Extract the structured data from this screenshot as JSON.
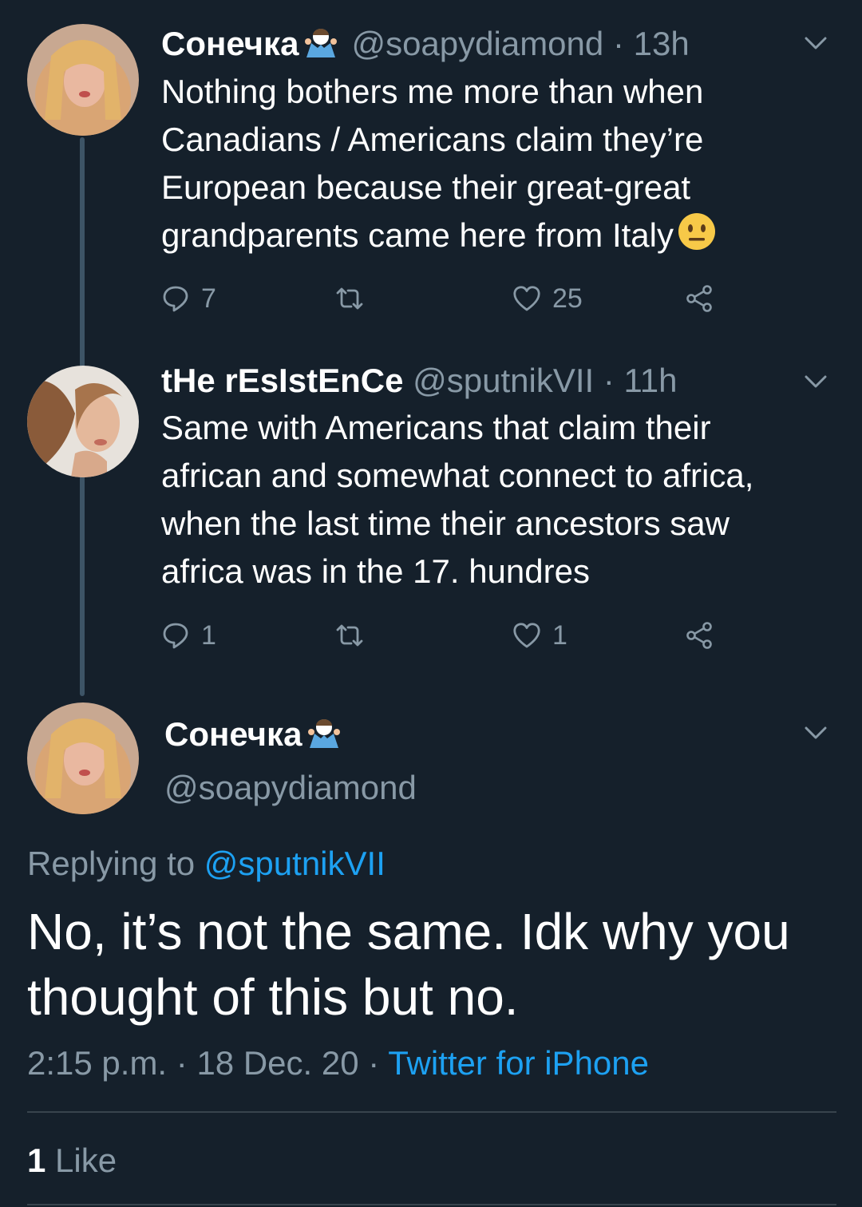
{
  "tweets": [
    {
      "name": "Сонечка",
      "handle": "@soapydiamond",
      "time": "13h",
      "text_lines": [
        "Nothing bothers me more than when",
        "Canadians / Americans claim they’re",
        "European because their great-great",
        "grandparents came here from Italy"
      ],
      "trailing_emoji": "neutral-face",
      "replies": "7",
      "retweets": "",
      "likes": "25"
    },
    {
      "name": "tHe rEsIstEnCe",
      "handle": "@sputnikVII",
      "time": "11h",
      "text_lines": [
        "Same with Americans that claim their",
        "african and somewhat connect to africa,",
        "when the last time their ancestors saw",
        "africa was in the 17. hundres"
      ],
      "replies": "1",
      "retweets": "",
      "likes": "1"
    }
  ],
  "focused": {
    "name": "Сонечка",
    "handle": "@soapydiamond",
    "replying_label": "Replying to",
    "replying_to": "@sputnikVII",
    "text_lines": [
      "No, it’s not the same. Idk why you",
      "thought of this but no."
    ],
    "time": "2:15 p.m.",
    "date": "18 Dec. 20",
    "source": "Twitter for iPhone",
    "like_count": "1",
    "like_label": "Like"
  },
  "separator": "·",
  "colors": {
    "background": "#15202b",
    "muted": "#8899a6",
    "link": "#1da1f2",
    "thread_line": "#3d5466"
  }
}
